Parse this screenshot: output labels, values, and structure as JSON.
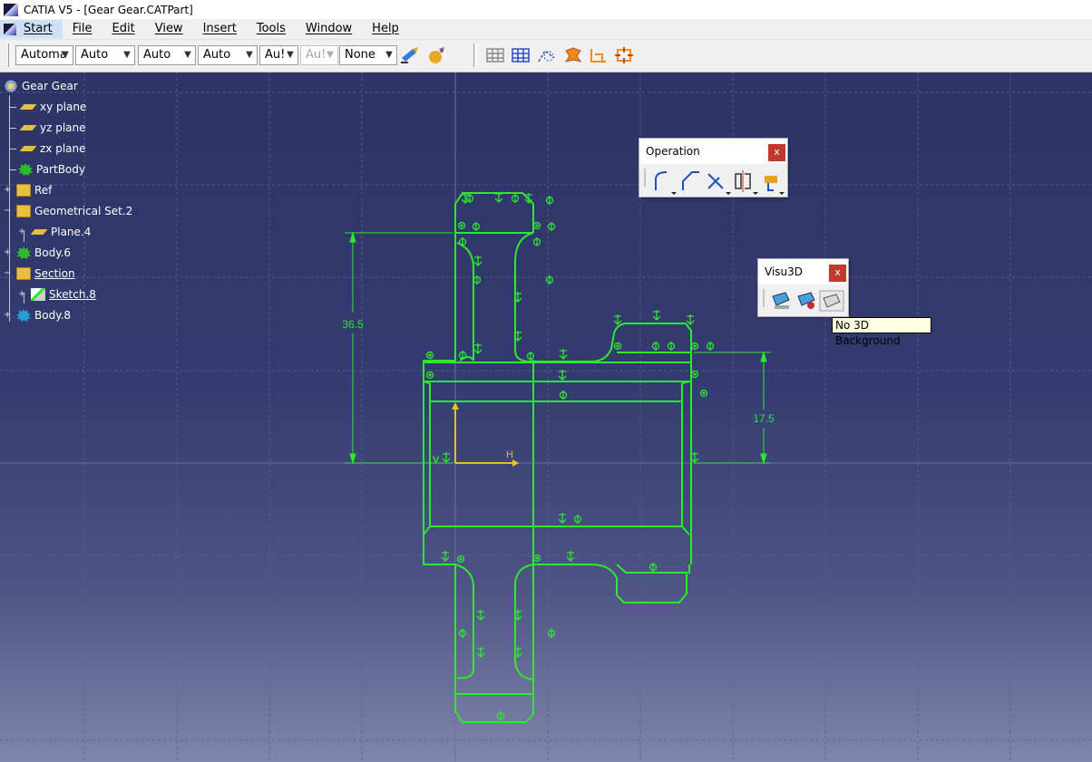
{
  "window": {
    "title": "CATIA V5 - [Gear Gear.CATPart]"
  },
  "menu": {
    "items": [
      "Start",
      "File",
      "Edit",
      "View",
      "Insert",
      "Tools",
      "Window",
      "Help"
    ]
  },
  "toolbar": {
    "combos": [
      {
        "value": "Automa",
        "enabled": true
      },
      {
        "value": "Auto",
        "enabled": true
      },
      {
        "value": "Auto",
        "enabled": true
      },
      {
        "value": "Auto",
        "enabled": true
      },
      {
        "value": "Au!",
        "enabled": true
      },
      {
        "value": "Au!",
        "enabled": false
      },
      {
        "value": "None",
        "enabled": true
      }
    ]
  },
  "tree": {
    "nodes": [
      {
        "label": "Gear Gear",
        "icon": "part-icon"
      },
      {
        "label": "xy plane",
        "icon": "plane-icon"
      },
      {
        "label": "yz plane",
        "icon": "plane-icon"
      },
      {
        "label": "zx plane",
        "icon": "plane-icon"
      },
      {
        "label": "PartBody",
        "icon": "body-icon"
      },
      {
        "label": "Ref",
        "icon": "geometrical-set-icon"
      },
      {
        "label": "Geometrical Set.2",
        "icon": "geometrical-set-icon"
      },
      {
        "label": "Plane.4",
        "icon": "plane-icon"
      },
      {
        "label": "Body.6",
        "icon": "body-icon"
      },
      {
        "label": "Section",
        "icon": "geometrical-set-icon"
      },
      {
        "label": "Sketch.8",
        "icon": "sketch-icon"
      },
      {
        "label": "Body.8",
        "icon": "body-icon"
      }
    ]
  },
  "panels": {
    "operation": {
      "title": "Operation",
      "close": "x",
      "tools": [
        "corner-icon",
        "chamfer-icon",
        "trim-icon",
        "mirror-icon",
        "project-3d-elements-icon"
      ]
    },
    "visu3d": {
      "title": "Visu3D",
      "close": "x",
      "tools": [
        "cut-part-by-sketch-plane-icon",
        "visu3d-pinned-icon",
        "no-3d-background-icon"
      ]
    }
  },
  "tooltip": {
    "text": "No 3D Background"
  },
  "sketch": {
    "dimensions": [
      "36.5",
      "17.5"
    ],
    "axes": {
      "h": "H",
      "v": "V"
    },
    "profile_color": "#2ee82e",
    "axis_color": "#e8c020",
    "dimension_color": "#2ee82e"
  }
}
